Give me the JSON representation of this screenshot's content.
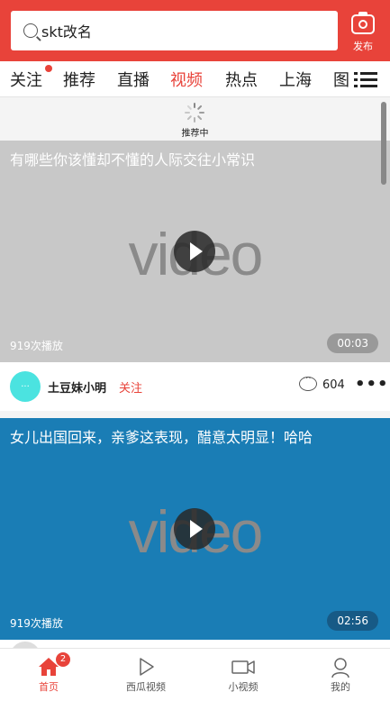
{
  "header": {
    "search": {
      "value": "skt改名"
    },
    "publish_label": "发布"
  },
  "tabs": [
    {
      "label": "关注",
      "has_dot": true
    },
    {
      "label": "推荐"
    },
    {
      "label": "直播"
    },
    {
      "label": "视频",
      "active": true
    },
    {
      "label": "热点"
    },
    {
      "label": "上海"
    },
    {
      "label": "图"
    }
  ],
  "loading": {
    "text": "推荐中"
  },
  "videos": [
    {
      "title": "有哪些你该懂却不懂的人际交往小常识",
      "watermark": "video",
      "plays": "919次播放",
      "duration": "00:03",
      "bg": "#c8c8c8",
      "duration_bg": "#999999",
      "author": "土豆妹小明",
      "follow": "关注",
      "comments": "604"
    },
    {
      "title": "女儿出国回来，亲爹这表现，醋意太明显！哈哈",
      "watermark": "video",
      "plays": "919次播放",
      "duration": "02:56",
      "bg": "#1a7db5",
      "duration_bg": "#175a86"
    }
  ],
  "bottom_nav": [
    {
      "label": "首页",
      "active": true,
      "badge": "2",
      "icon": "home-icon"
    },
    {
      "label": "西瓜视频",
      "icon": "play-outline-icon"
    },
    {
      "label": "小视频",
      "icon": "video-camera-icon"
    },
    {
      "label": "我的",
      "icon": "user-icon"
    }
  ],
  "colors": {
    "accent": "#e8433a",
    "avatar": "#4be3e0"
  }
}
